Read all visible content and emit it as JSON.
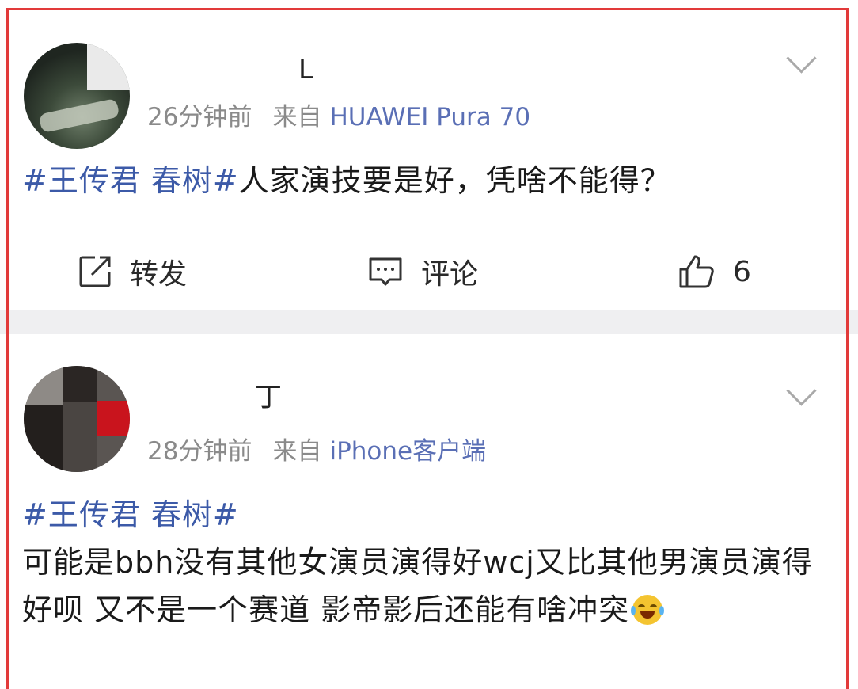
{
  "posts": [
    {
      "name_visible": "L",
      "time": "26分钟前",
      "source_prefix": "来自",
      "device": "HUAWEI Pura 70",
      "topic": "#王传君 春树#",
      "text": "人家演技要是好，凭啥不能得？",
      "actions": {
        "repost_label": "转发",
        "comment_label": "评论",
        "like_count": "6"
      }
    },
    {
      "name_visible": "丁",
      "time": "28分钟前",
      "source_prefix": "来自",
      "device": "iPhone客户端",
      "topic": "#王传君 春树#",
      "text": "可能是bbh没有其他女演员演得好wcj又比其他男演员演得好呗 又不是一个赛道 影帝影后还能有啥冲突",
      "emoji": "laughing-crying"
    }
  ],
  "colors": {
    "frame": "#e23a3a",
    "topic": "#3c5aa8",
    "meta": "#8a8a8a",
    "device": "#5a6fb5",
    "divider": "#efeff1"
  }
}
